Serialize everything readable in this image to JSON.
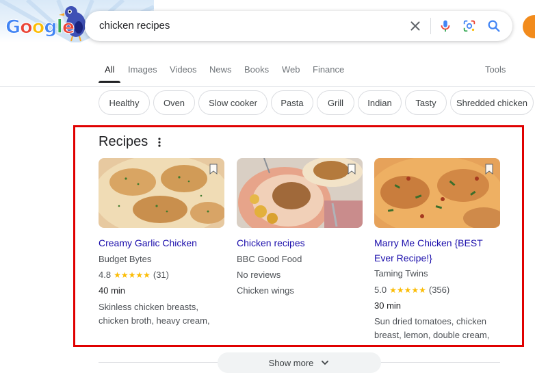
{
  "doodle": {
    "letters": [
      "G",
      "o",
      "o",
      "g",
      "l",
      "e"
    ],
    "colors": [
      "#4285f4",
      "#ea4335",
      "#fbbc05",
      "#4285f4",
      "#34a853",
      "#ea4335"
    ]
  },
  "search": {
    "query": "chicken recipes"
  },
  "tabs": [
    {
      "label": "All",
      "active": true
    },
    {
      "label": "Images"
    },
    {
      "label": "Videos"
    },
    {
      "label": "News"
    },
    {
      "label": "Books"
    },
    {
      "label": "Web"
    },
    {
      "label": "Finance"
    }
  ],
  "tools_label": "Tools",
  "chips": [
    "Healthy",
    "Oven",
    "Slow cooker",
    "Pasta",
    "Grill",
    "Indian",
    "Tasty",
    "Shredded chicken"
  ],
  "recipes": {
    "heading": "Recipes",
    "cards": [
      {
        "title": "Creamy Garlic Chicken",
        "source": "Budget Bytes",
        "rating": "4.8",
        "reviews": "(31)",
        "time": "40 min",
        "ingredients": "Skinless chicken breasts, chicken broth, heavy cream,"
      },
      {
        "title": "Chicken recipes",
        "source": "BBC Good Food",
        "no_reviews": "No reviews",
        "ingredients": "Chicken wings"
      },
      {
        "title": "Marry Me Chicken {BEST Ever Recipe!}",
        "source": "Taming Twins",
        "rating": "5.0",
        "reviews": "(356)",
        "time": "30 min",
        "ingredients": "Sun dried tomatoes, chicken breast, lemon, double cream,"
      }
    ]
  },
  "show_more": "Show more",
  "colors": {
    "link": "#1a0dab",
    "star": "#fbbc04",
    "highlight": "#e00000"
  }
}
